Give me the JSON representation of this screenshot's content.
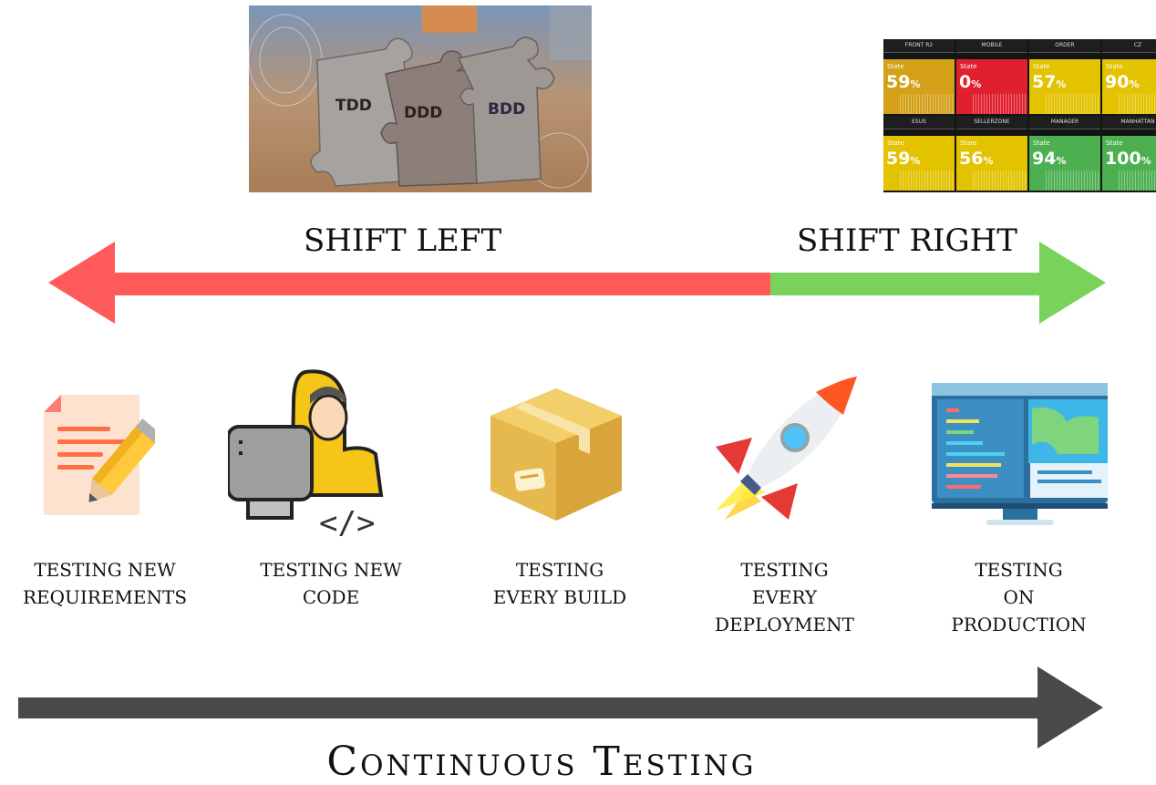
{
  "puzzle_photo": {
    "pieces": [
      "TDD",
      "DDD",
      "BDD"
    ]
  },
  "dashboard": {
    "tiles": [
      {
        "head": "FRONT R2",
        "state": "State",
        "value": "59",
        "unit": "%",
        "color": "#d4a017"
      },
      {
        "head": "MOBILE",
        "state": "State",
        "value": "0",
        "unit": "%",
        "color": "#e0202e"
      },
      {
        "head": "ORDER",
        "state": "State",
        "value": "57",
        "unit": "%",
        "color": "#e3c200"
      },
      {
        "head": "CZ",
        "state": "State",
        "value": "90",
        "unit": "%",
        "color": "#e3c200"
      },
      {
        "head": "ESUS",
        "state": "State",
        "value": "59",
        "unit": "%",
        "color": "#e3c200"
      },
      {
        "head": "SELLERZONE",
        "state": "State",
        "value": "56",
        "unit": "%",
        "color": "#e3c200"
      },
      {
        "head": "MANAGER",
        "state": "State",
        "value": "94",
        "unit": "%",
        "color": "#4caf50"
      },
      {
        "head": "MANHATTAN",
        "state": "State",
        "value": "100",
        "unit": "%",
        "color": "#4caf50"
      }
    ]
  },
  "shift": {
    "left_label": "SHIFT LEFT",
    "right_label": "SHIFT RIGHT",
    "left_color": "#ff5a5a",
    "right_color": "#79d35a"
  },
  "stages": [
    {
      "label": "TESTING  NEW\nREQUIREMENTS",
      "icon": "document-pencil-icon"
    },
    {
      "label": "TESTING NEW\nCODE",
      "icon": "developer-computer-icon"
    },
    {
      "label": "TESTING\nEVERY BUILD",
      "icon": "package-box-icon"
    },
    {
      "label": "TESTING\nEVERY\nDEPLOYMENT",
      "icon": "rocket-icon"
    },
    {
      "label": "TESTING\nON\nPRODUCTION",
      "icon": "monitor-dashboard-icon"
    }
  ],
  "continuous": {
    "title": "Continuous Testing",
    "arrow_color": "#4a4a4a"
  }
}
